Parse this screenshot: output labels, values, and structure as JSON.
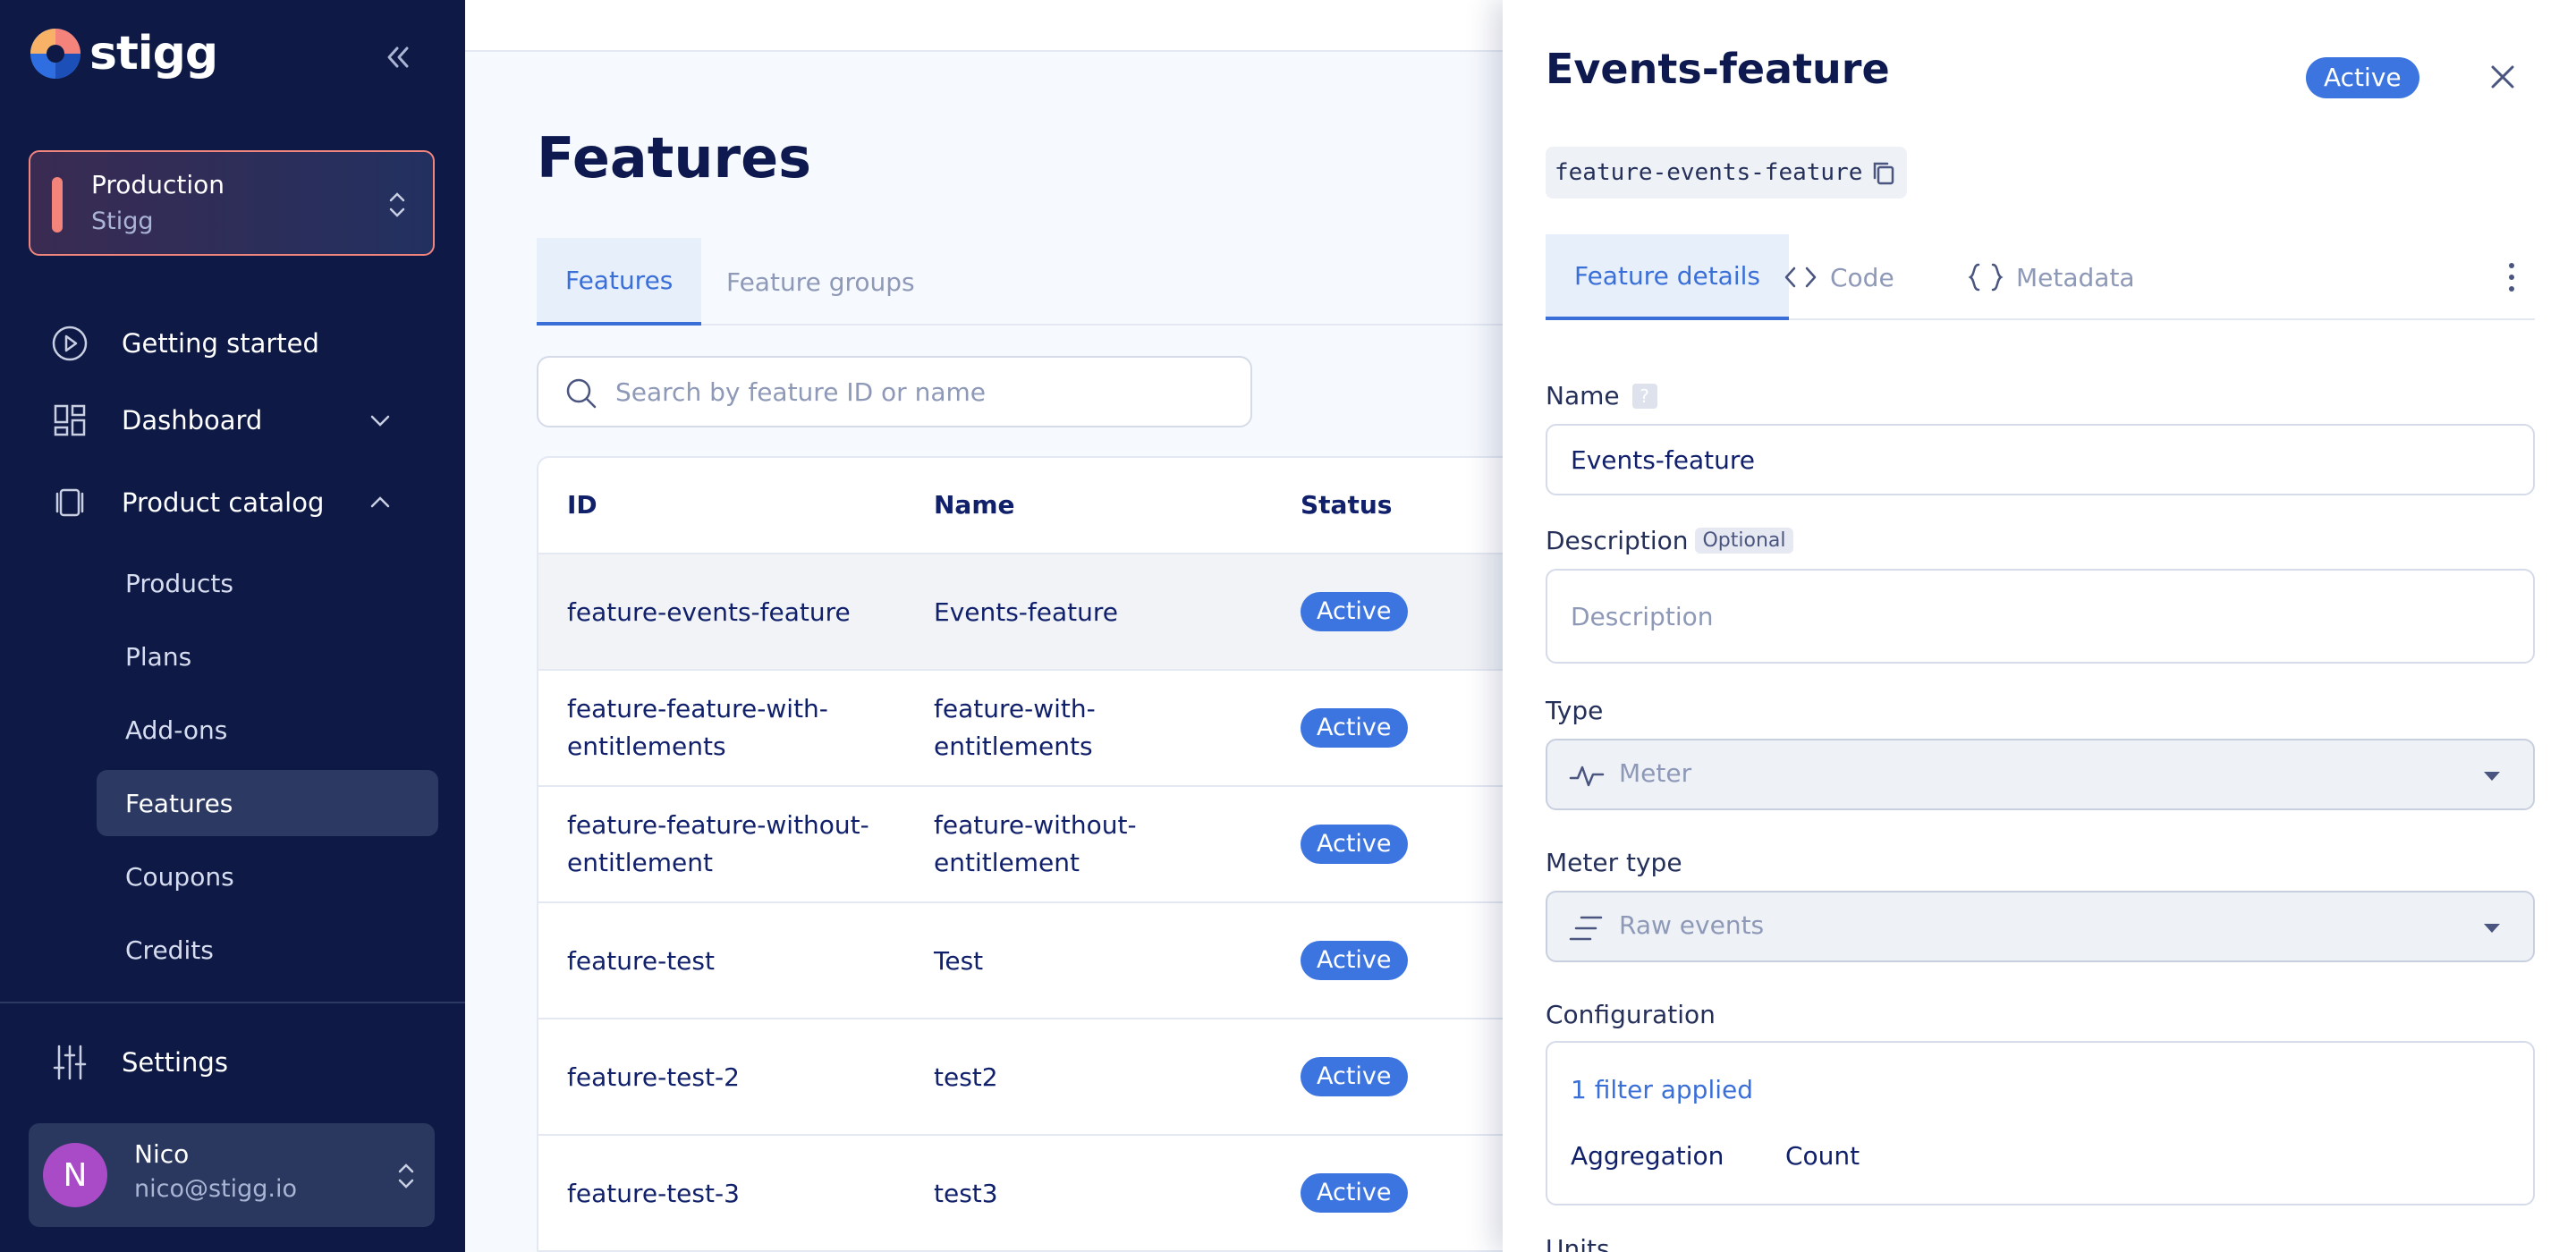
{
  "brand": {
    "name": "stigg"
  },
  "environment": {
    "name": "Production",
    "org": "Stigg"
  },
  "nav": {
    "getting_started": "Getting started",
    "dashboard": "Dashboard",
    "product_catalog": "Product catalog",
    "sub_items": [
      "Products",
      "Plans",
      "Add-ons",
      "Features",
      "Coupons",
      "Credits"
    ],
    "active_sub_item": "Features",
    "settings": "Settings"
  },
  "user": {
    "initial": "N",
    "name": "Nico",
    "email": "nico@stigg.io"
  },
  "page": {
    "title": "Features",
    "tabs": [
      "Features",
      "Feature groups"
    ],
    "active_tab": "Features",
    "search_placeholder": "Search by feature ID or name"
  },
  "table": {
    "columns": [
      "ID",
      "Name",
      "Status"
    ],
    "rows": [
      {
        "id": "feature-events-feature",
        "name": "Events-feature",
        "status": "Active"
      },
      {
        "id": "feature-feature-with-entitlements",
        "name": "feature-with-entitlements",
        "status": "Active"
      },
      {
        "id": "feature-feature-without-entitlement",
        "name": "feature-without-entitlement",
        "status": "Active"
      },
      {
        "id": "feature-test",
        "name": "Test",
        "status": "Active"
      },
      {
        "id": "feature-test-2",
        "name": "test2",
        "status": "Active"
      },
      {
        "id": "feature-test-3",
        "name": "test3",
        "status": "Active"
      }
    ]
  },
  "drawer": {
    "title": "Events-feature",
    "status": "Active",
    "feature_id": "feature-events-feature",
    "tabs": [
      "Feature details",
      "Code",
      "Metadata"
    ],
    "active_tab": "Feature details",
    "fields": {
      "name_label": "Name",
      "name_help": "?",
      "name_value": "Events-feature",
      "description_label": "Description",
      "description_optional": "Optional",
      "description_placeholder": "Description",
      "type_label": "Type",
      "type_value": "Meter",
      "meter_type_label": "Meter type",
      "meter_type_value": "Raw events",
      "configuration_label": "Configuration",
      "filter_link": "1 filter applied",
      "aggregation_label": "Aggregation",
      "aggregation_value": "Count",
      "units_label": "Units"
    }
  },
  "colors": {
    "sidebar_bg": "#0e1a45",
    "accent": "#3d75e0",
    "env_accent": "#f4847b",
    "avatar": "#a94bc7"
  }
}
